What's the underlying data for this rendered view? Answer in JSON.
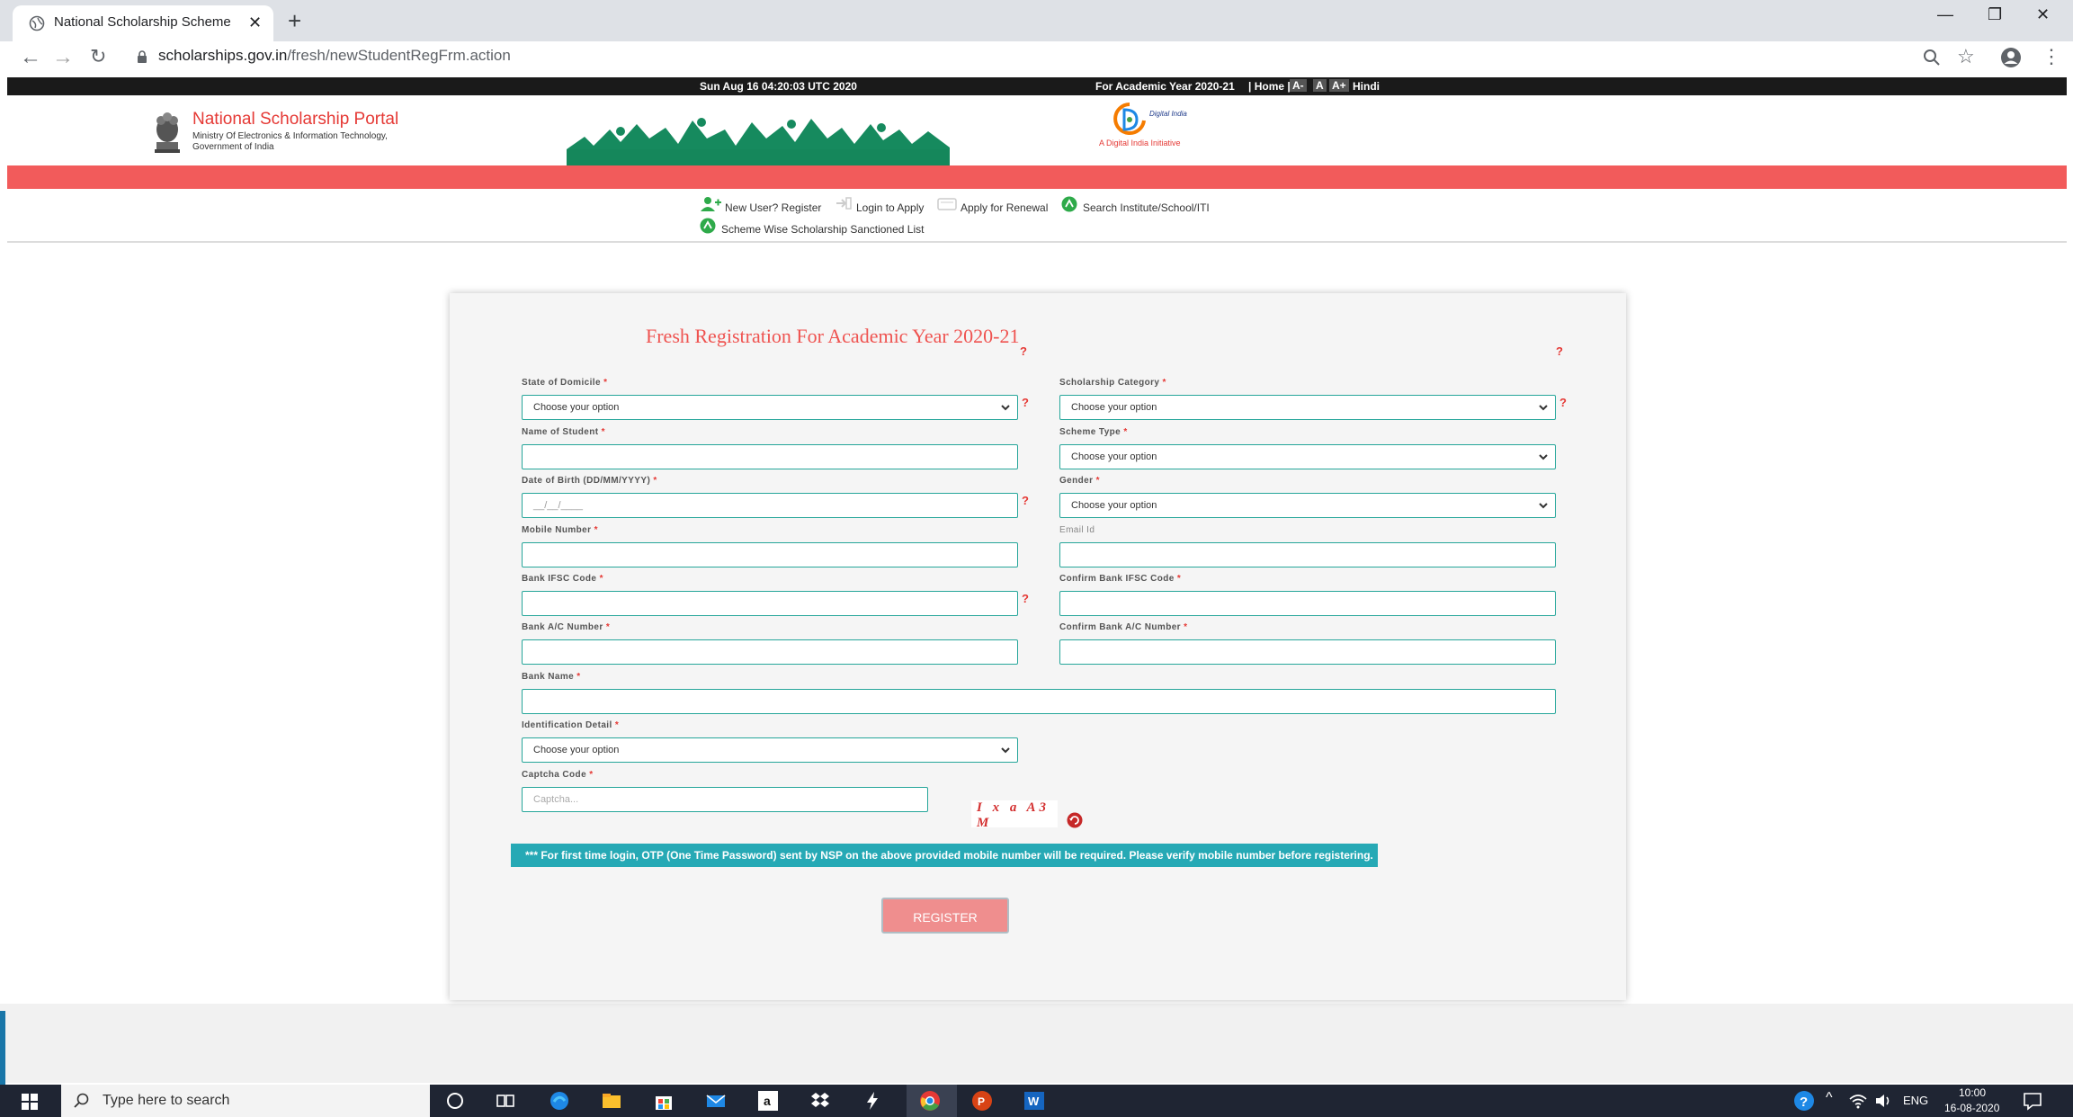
{
  "browser": {
    "tab_title": "National Scholarship Scheme",
    "url_domain": "scholarships.gov.in",
    "url_path": "/fresh/newStudentRegFrm.action"
  },
  "topbar": {
    "datetime": "Sun Aug 16 04:20:03 UTC 2020",
    "academic_year": "For Academic Year 2020-21",
    "home": "| Home |",
    "font_small": "A-",
    "font_normal": "A",
    "font_large": "A+",
    "language": "Hindi"
  },
  "header": {
    "portal_title": "National Scholarship Portal",
    "ministry_line1": "Ministry Of Electronics & Information Technology,",
    "ministry_line2": "Government of India",
    "digital_india_tagline": "A Digital India Initiative",
    "digital_india_logo_text": "Digital India"
  },
  "nav": {
    "new_user": "New User? Register",
    "login": "Login to Apply",
    "renewal": "Apply for Renewal",
    "search_institute": "Search Institute/School/ITI",
    "scheme_list": "Scheme Wise Scholarship Sanctioned List"
  },
  "form": {
    "title": "Fresh Registration For Academic Year 2020-21",
    "help_mark": "?",
    "required_mark": "*",
    "state_label": "State of Domicile",
    "state_value": "Choose your option",
    "category_label": "Scholarship Category",
    "category_value": "Choose your option",
    "name_label": "Name of Student",
    "scheme_type_label": "Scheme Type",
    "scheme_type_value": "Choose your option",
    "dob_label": "Date of Birth (DD/MM/YYYY)",
    "dob_placeholder": "__/__/____",
    "gender_label": "Gender",
    "gender_value": "Choose your option",
    "mobile_label": "Mobile Number",
    "email_label": "Email Id",
    "ifsc_label": "Bank IFSC Code",
    "confirm_ifsc_label": "Confirm Bank IFSC Code",
    "account_label": "Bank A/C Number",
    "confirm_account_label": "Confirm Bank A/C Number",
    "bank_name_label": "Bank Name",
    "identification_label": "Identification Detail",
    "identification_value": "Choose your option",
    "captcha_label": "Captcha Code",
    "captcha_placeholder": "Captcha...",
    "captcha_text": "I x a A3 M",
    "notice": "*** For first time login, OTP (One Time Password) sent by NSP on the above provided mobile number will be required. Please verify mobile number before registering.",
    "register_button": "REGISTER"
  },
  "taskbar": {
    "search_placeholder": "Type here to search",
    "language": "ENG",
    "time": "10:00",
    "date": "16-08-2020"
  },
  "colors": {
    "accent_red": "#f25b5b",
    "title_red": "#ef5350",
    "field_border": "#26a69a",
    "notice_bg": "#26a9b5",
    "register_bg": "#ef8e8e"
  }
}
